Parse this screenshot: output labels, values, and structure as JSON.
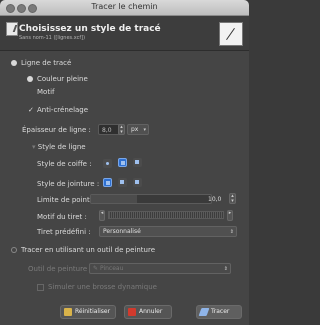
{
  "window": {
    "title": "Tracer le chemin"
  },
  "header": {
    "title": "Choisissez un style de tracé",
    "subtitle": "Sans nom-11 ([lignes.xcf])"
  },
  "line_stroke": {
    "label": "Ligne de tracé",
    "fill_option": "Couleur pleine",
    "motif_option": "Motif",
    "antialias_label": "Anti-crénelage",
    "width_label": "Épaisseur de ligne :",
    "width_value": "8,0",
    "unit": "px",
    "line_style_label": "Style de ligne",
    "cap_label": "Style de coiffe :",
    "join_label": "Style de jointure :",
    "miter_label": "Limite de pointe :",
    "miter_value": "10,0",
    "dash_pattern_label": "Motif du tiret :",
    "dash_preset_label": "Tiret prédéfini :",
    "dash_preset_value": "Personnalisé"
  },
  "paint_tool": {
    "label": "Tracer en utilisant un outil de peinture",
    "tool_label": "Outil de peinture",
    "tool_value": "Pinceau",
    "emulate_label": "Simuler une brosse dynamique"
  },
  "buttons": {
    "reset": "Réinitialiser",
    "cancel": "Annuler",
    "stroke": "Tracer"
  }
}
